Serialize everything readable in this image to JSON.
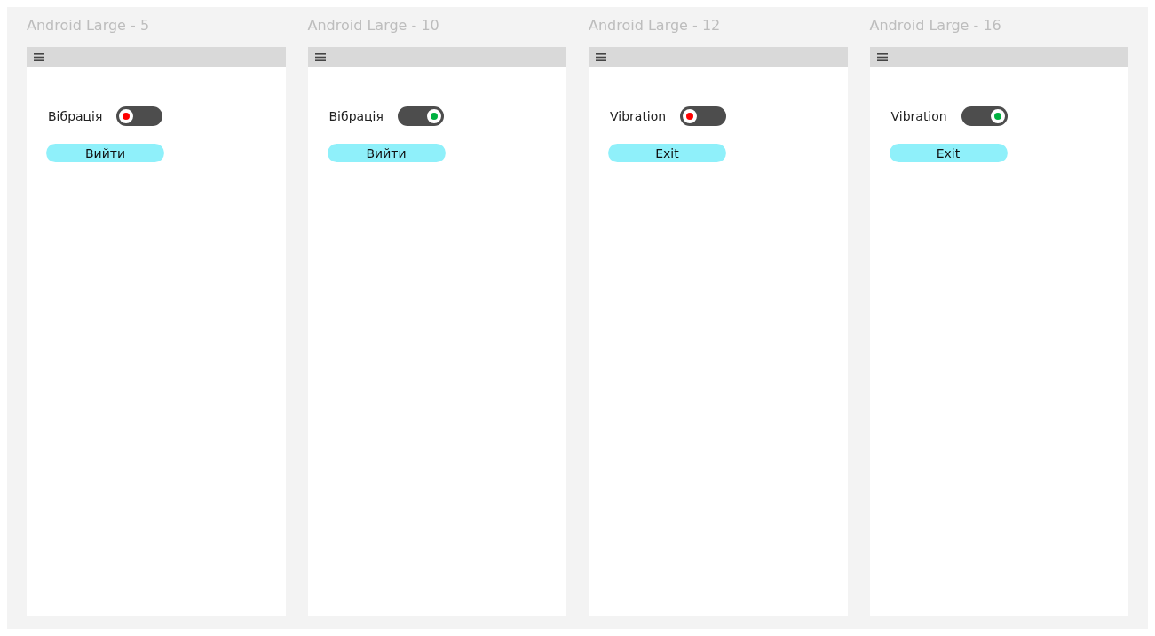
{
  "frames": [
    {
      "title": "Android Large - 5",
      "vibration": {
        "label": "Вібрація",
        "on": false
      },
      "exit_button": "Вийти"
    },
    {
      "title": "Android Large - 10",
      "vibration": {
        "label": "Вібрація",
        "on": true
      },
      "exit_button": "Вийти"
    },
    {
      "title": "Android Large - 12",
      "vibration": {
        "label": "Vibration",
        "on": false
      },
      "exit_button": "Exit"
    },
    {
      "title": "Android Large - 16",
      "vibration": {
        "label": "Vibration",
        "on": true
      },
      "exit_button": "Exit"
    }
  ]
}
